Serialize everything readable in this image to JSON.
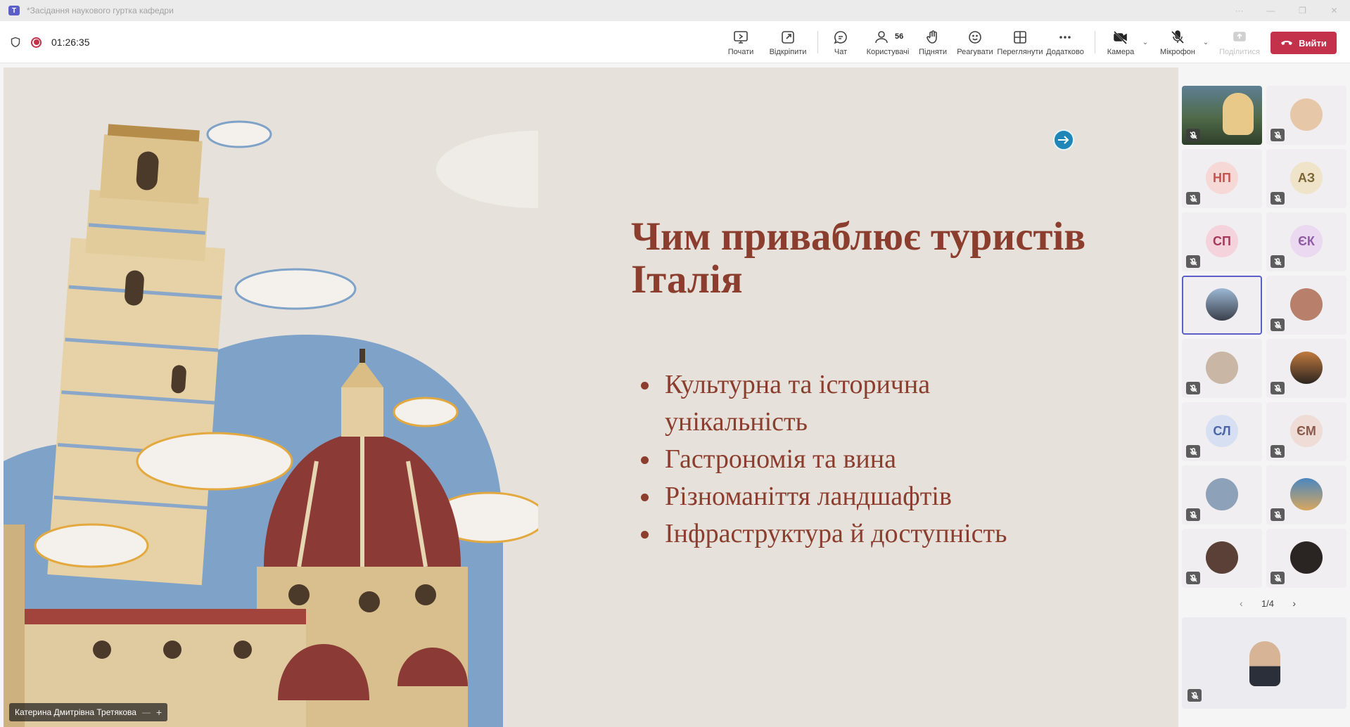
{
  "window": {
    "title": "*Засідання наукового гуртка кафедри",
    "app_icon": "teams-logo"
  },
  "meeting": {
    "timer": "01:26:35",
    "participants_count": "56",
    "leave_label": "Вийти"
  },
  "toolbar": {
    "buttons": [
      {
        "label": "Почати",
        "icon": "share-screen-icon"
      },
      {
        "label": "Відкріпити",
        "icon": "pop-out-icon"
      },
      {
        "label": "Чат",
        "icon": "chat-icon"
      },
      {
        "label": "Користувачі",
        "icon": "people-icon"
      },
      {
        "label": "Підняти",
        "icon": "raise-hand-icon"
      },
      {
        "label": "Реагувати",
        "icon": "react-icon"
      },
      {
        "label": "Переглянути",
        "icon": "view-icon"
      },
      {
        "label": "Додатково",
        "icon": "more-icon"
      },
      {
        "label": "Камера",
        "icon": "camera-off-icon"
      },
      {
        "label": "Мікрофон",
        "icon": "mic-off-icon"
      },
      {
        "label": "Поділитися",
        "icon": "share-icon"
      }
    ]
  },
  "slide": {
    "title_line1": "Чим приваблює туристів",
    "title_line2": "Італія",
    "bullets": [
      "Культурна та історична унікальність",
      "Гастрономія та вина",
      "Різноманіття ландшафтів",
      "Інфраструктура й доступність"
    ]
  },
  "presenter": {
    "name": "Катерина Дмитрівна Третякова"
  },
  "gallery": {
    "tiles": [
      {
        "initials": "",
        "kind": "video"
      },
      {
        "initials": "",
        "kind": "photo"
      },
      {
        "initials": "НП",
        "kind": "initials",
        "color": "#c0564f",
        "bg": "#f6d9d6"
      },
      {
        "initials": "АЗ",
        "kind": "initials",
        "color": "#7a6536",
        "bg": "#efe4c9"
      },
      {
        "initials": "СП",
        "kind": "initials",
        "color": "#a5385c",
        "bg": "#f5d3dd"
      },
      {
        "initials": "ЄК",
        "kind": "initials",
        "color": "#8f5ba3",
        "bg": "#ead9f0"
      },
      {
        "initials": "",
        "kind": "photo"
      },
      {
        "initials": "",
        "kind": "photo"
      },
      {
        "initials": "",
        "kind": "photo"
      },
      {
        "initials": "",
        "kind": "photo"
      },
      {
        "initials": "СЛ",
        "kind": "initials",
        "color": "#4b66a8",
        "bg": "#d7e0f3"
      },
      {
        "initials": "ЄМ",
        "kind": "initials",
        "color": "#8a5a4c",
        "bg": "#efdcd6"
      },
      {
        "initials": "",
        "kind": "photo"
      },
      {
        "initials": "",
        "kind": "photo"
      },
      {
        "initials": "",
        "kind": "photo"
      },
      {
        "initials": "",
        "kind": "photo"
      }
    ],
    "page": "1/4"
  },
  "colors": {
    "accent": "#5b5fc7",
    "leave": "#c4314b",
    "slide_text": "#8b3e2e",
    "slide_bg": "#e7e1db"
  }
}
